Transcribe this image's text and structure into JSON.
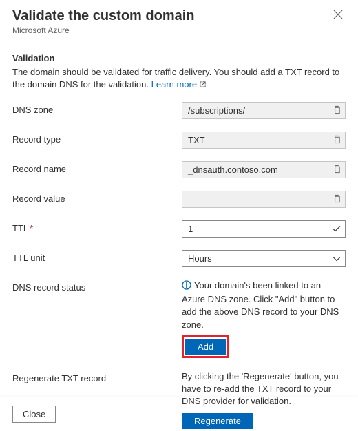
{
  "header": {
    "title": "Validate the custom domain",
    "subtitle": "Microsoft Azure"
  },
  "validation": {
    "heading": "Validation",
    "description": "The domain should be validated for traffic delivery. You should add a TXT record to the domain DNS for the validation. ",
    "learn_more": "Learn more"
  },
  "fields": {
    "dns_zone": {
      "label": "DNS zone",
      "value": "/subscriptions/"
    },
    "record_type": {
      "label": "Record type",
      "value": "TXT"
    },
    "record_name": {
      "label": "Record name",
      "value": "_dnsauth.contoso.com"
    },
    "record_value": {
      "label": "Record value",
      "value": ""
    },
    "ttl": {
      "label": "TTL",
      "value": "1",
      "required": true
    },
    "ttl_unit": {
      "label": "TTL unit",
      "value": "Hours"
    }
  },
  "status": {
    "label": "DNS record status",
    "text": "Your domain's been linked to an Azure DNS zone. Click \"Add\" button to add the above DNS record to your DNS zone.",
    "add_button": "Add"
  },
  "regenerate": {
    "label": "Regenerate TXT record",
    "text": "By clicking the 'Regenerate' button, you have to re-add the TXT record to your DNS provider for validation.",
    "button": "Regenerate"
  },
  "footer": {
    "close": "Close"
  },
  "colors": {
    "link": "#0067b8",
    "primary_button": "#0067b8",
    "highlight_border": "#e8202a"
  }
}
